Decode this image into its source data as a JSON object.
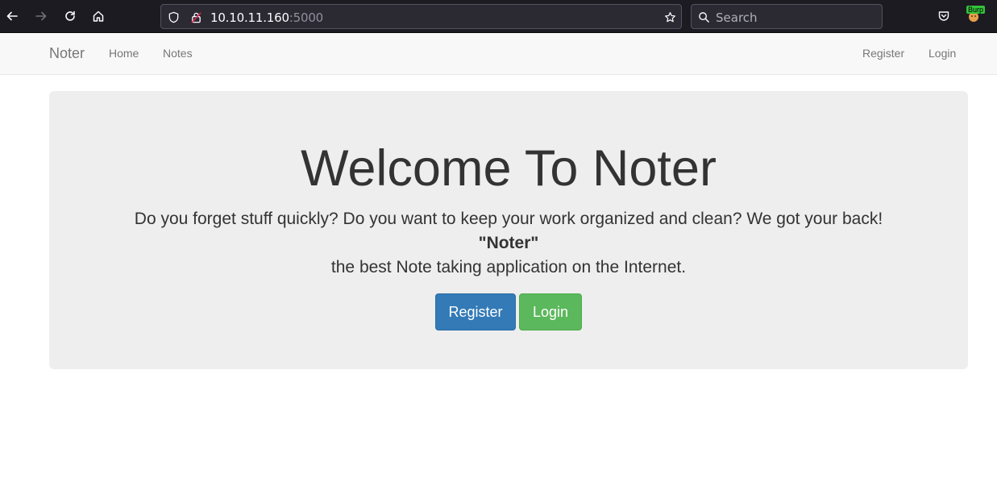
{
  "browser": {
    "url_host": "10.10.11.160",
    "url_port": ":5000",
    "search_placeholder": "Search",
    "extension_badge": "Burp"
  },
  "navbar": {
    "brand": "Noter",
    "left_links": [
      "Home",
      "Notes"
    ],
    "right_links": [
      "Register",
      "Login"
    ]
  },
  "hero": {
    "title": "Welcome To Noter",
    "line1": "Do you forget stuff quickly? Do you want to keep your work organized and clean? We got your back!",
    "line2": "\"Noter\"",
    "line3": "the best Note taking application on the Internet.",
    "register_button": "Register",
    "login_button": "Login"
  },
  "colors": {
    "primary": "#337ab7",
    "success": "#5cb85c",
    "jumbotron_bg": "#eeeeee"
  }
}
